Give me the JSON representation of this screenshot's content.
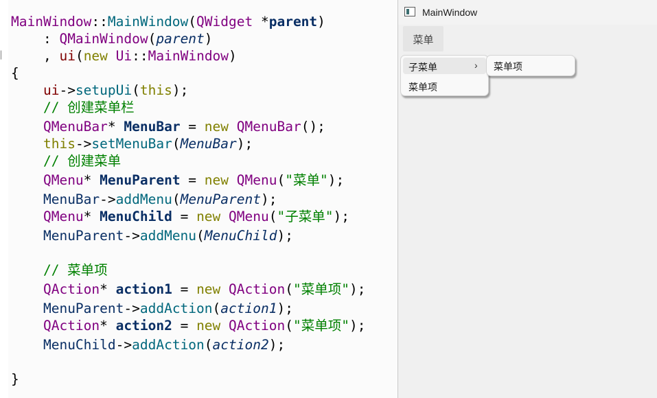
{
  "editor": {
    "gutter_mark": "▏",
    "lines": [
      [
        [
          "MainWindow",
          "c-type"
        ],
        [
          "::",
          "c-punct"
        ],
        [
          "MainWindow",
          "c-cls"
        ],
        [
          "(",
          "c-punct"
        ],
        [
          "QWidget",
          "c-type"
        ],
        [
          " *",
          "c-punct"
        ],
        [
          "parent",
          "c-var"
        ],
        [
          ")",
          "c-punct"
        ]
      ],
      [
        [
          "    : ",
          "c-punct"
        ],
        [
          "QMainWindow",
          "c-type"
        ],
        [
          "(",
          "c-punct"
        ],
        [
          "parent",
          "c-param"
        ],
        [
          ")",
          "c-punct"
        ]
      ],
      [
        [
          "    , ",
          "c-punct"
        ],
        [
          "ui",
          "c-mem"
        ],
        [
          "(",
          "c-punct"
        ],
        [
          "new",
          "c-kw"
        ],
        [
          " ",
          "c-punct"
        ],
        [
          "Ui",
          "c-type"
        ],
        [
          "::",
          "c-punct"
        ],
        [
          "MainWindow",
          "c-type"
        ],
        [
          ")",
          "c-punct"
        ]
      ],
      [
        [
          "{",
          "c-punct"
        ]
      ],
      [
        [
          "    ",
          "c-punct"
        ],
        [
          "ui",
          "c-mem"
        ],
        [
          "->",
          "c-punct"
        ],
        [
          "setupUi",
          "c-func"
        ],
        [
          "(",
          "c-punct"
        ],
        [
          "this",
          "c-kw"
        ],
        [
          ");",
          "c-punct"
        ]
      ],
      [
        [
          "    // 创建菜单栏",
          "c-com"
        ]
      ],
      [
        [
          "    ",
          "c-punct"
        ],
        [
          "QMenuBar",
          "c-type"
        ],
        [
          "* ",
          "c-punct"
        ],
        [
          "MenuBar",
          "c-var"
        ],
        [
          " = ",
          "c-punct"
        ],
        [
          "new",
          "c-kw"
        ],
        [
          " ",
          "c-punct"
        ],
        [
          "QMenuBar",
          "c-type"
        ],
        [
          "();",
          "c-punct"
        ]
      ],
      [
        [
          "    ",
          "c-punct"
        ],
        [
          "this",
          "c-kw"
        ],
        [
          "->",
          "c-punct"
        ],
        [
          "setMenuBar",
          "c-func"
        ],
        [
          "(",
          "c-punct"
        ],
        [
          "MenuBar",
          "c-param"
        ],
        [
          ");",
          "c-punct"
        ]
      ],
      [
        [
          "    // 创建菜单",
          "c-com"
        ]
      ],
      [
        [
          "    ",
          "c-punct"
        ],
        [
          "QMenu",
          "c-type"
        ],
        [
          "* ",
          "c-punct"
        ],
        [
          "MenuParent",
          "c-var"
        ],
        [
          " = ",
          "c-punct"
        ],
        [
          "new",
          "c-kw"
        ],
        [
          " ",
          "c-punct"
        ],
        [
          "QMenu",
          "c-type"
        ],
        [
          "(",
          "c-punct"
        ],
        [
          "\"菜单\"",
          "c-str"
        ],
        [
          ");",
          "c-punct"
        ]
      ],
      [
        [
          "    ",
          "c-punct"
        ],
        [
          "MenuBar",
          "c-plain"
        ],
        [
          "->",
          "c-punct"
        ],
        [
          "addMenu",
          "c-func"
        ],
        [
          "(",
          "c-punct"
        ],
        [
          "MenuParent",
          "c-param"
        ],
        [
          ");",
          "c-punct"
        ]
      ],
      [
        [
          "    ",
          "c-punct"
        ],
        [
          "QMenu",
          "c-type"
        ],
        [
          "* ",
          "c-punct"
        ],
        [
          "MenuChild",
          "c-var"
        ],
        [
          " = ",
          "c-punct"
        ],
        [
          "new",
          "c-kw"
        ],
        [
          " ",
          "c-punct"
        ],
        [
          "QMenu",
          "c-type"
        ],
        [
          "(",
          "c-punct"
        ],
        [
          "\"子菜单\"",
          "c-str"
        ],
        [
          ");",
          "c-punct"
        ]
      ],
      [
        [
          "    ",
          "c-punct"
        ],
        [
          "MenuParent",
          "c-plain"
        ],
        [
          "->",
          "c-punct"
        ],
        [
          "addMenu",
          "c-func"
        ],
        [
          "(",
          "c-punct"
        ],
        [
          "MenuChild",
          "c-param"
        ],
        [
          ");",
          "c-punct"
        ]
      ],
      [
        [
          "",
          "c-punct"
        ]
      ],
      [
        [
          "    // 菜单项",
          "c-com"
        ]
      ],
      [
        [
          "    ",
          "c-punct"
        ],
        [
          "QAction",
          "c-type"
        ],
        [
          "* ",
          "c-punct"
        ],
        [
          "action1",
          "c-var"
        ],
        [
          " = ",
          "c-punct"
        ],
        [
          "new",
          "c-kw"
        ],
        [
          " ",
          "c-punct"
        ],
        [
          "QAction",
          "c-type"
        ],
        [
          "(",
          "c-punct"
        ],
        [
          "\"菜单项\"",
          "c-str"
        ],
        [
          ");",
          "c-punct"
        ]
      ],
      [
        [
          "    ",
          "c-punct"
        ],
        [
          "MenuParent",
          "c-plain"
        ],
        [
          "->",
          "c-punct"
        ],
        [
          "addAction",
          "c-func"
        ],
        [
          "(",
          "c-punct"
        ],
        [
          "action1",
          "c-param"
        ],
        [
          ");",
          "c-punct"
        ]
      ],
      [
        [
          "    ",
          "c-punct"
        ],
        [
          "QAction",
          "c-type"
        ],
        [
          "* ",
          "c-punct"
        ],
        [
          "action2",
          "c-var"
        ],
        [
          " = ",
          "c-punct"
        ],
        [
          "new",
          "c-kw"
        ],
        [
          " ",
          "c-punct"
        ],
        [
          "QAction",
          "c-type"
        ],
        [
          "(",
          "c-punct"
        ],
        [
          "\"菜单项\"",
          "c-str"
        ],
        [
          ");",
          "c-punct"
        ]
      ],
      [
        [
          "    ",
          "c-punct"
        ],
        [
          "MenuChild",
          "c-plain"
        ],
        [
          "->",
          "c-punct"
        ],
        [
          "addAction",
          "c-func"
        ],
        [
          "(",
          "c-punct"
        ],
        [
          "action2",
          "c-param"
        ],
        [
          ");",
          "c-punct"
        ]
      ],
      [
        [
          "",
          "c-punct"
        ]
      ],
      [
        [
          "}",
          "c-punct"
        ]
      ]
    ]
  },
  "window": {
    "title": "MainWindow",
    "icon": "window-app-icon",
    "menubar": {
      "menu_label": "菜单"
    },
    "parent_menu": {
      "submenu_label": "子菜单",
      "submenu_arrow": "›",
      "action_label": "菜单项"
    },
    "child_menu": {
      "action_label": "菜单项"
    }
  }
}
